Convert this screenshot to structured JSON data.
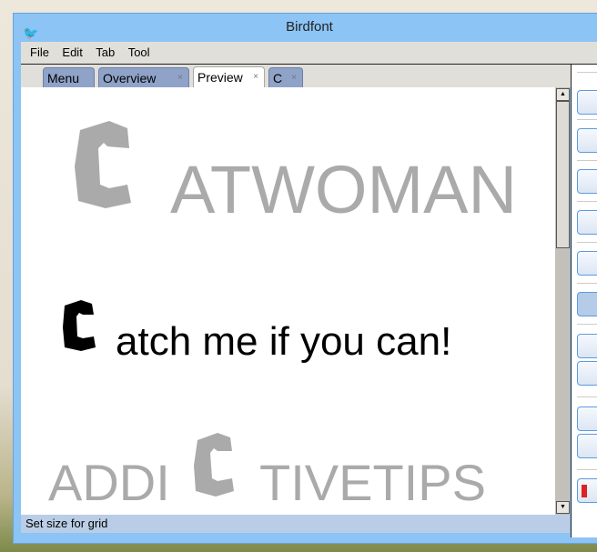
{
  "window": {
    "title": "Birdfont"
  },
  "menu": [
    "File",
    "Edit",
    "Tab",
    "Tool"
  ],
  "tabs": [
    {
      "label": "Menu"
    },
    {
      "label": "Overview"
    },
    {
      "label": "Preview",
      "active": true
    },
    {
      "label": "C"
    }
  ],
  "close_glyph": "×",
  "preview": {
    "line1": "ATWOMAN",
    "line2": "atch me if you can!",
    "line3a": "ADDI",
    "line3b": "TIVETIPS"
  },
  "status": "Set size for grid"
}
